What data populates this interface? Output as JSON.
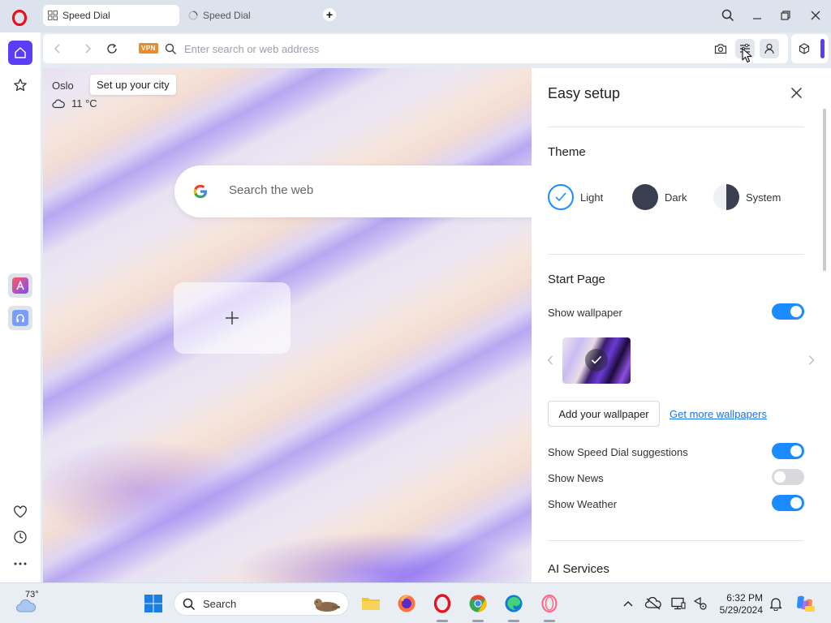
{
  "tabs": [
    {
      "label": "Speed Dial",
      "active": true
    },
    {
      "label": "Speed Dial",
      "active": false
    }
  ],
  "addressbar": {
    "vpn_label": "VPN",
    "placeholder": "Enter search or web address"
  },
  "weather": {
    "city": "Oslo",
    "city_tooltip": "Set up your city",
    "temperature": "11 °C"
  },
  "search": {
    "placeholder": "Search the web"
  },
  "easy_setup": {
    "title": "Easy setup",
    "theme_section": "Theme",
    "themes": [
      {
        "label": "Light",
        "selected": true
      },
      {
        "label": "Dark",
        "selected": false
      },
      {
        "label": "System",
        "selected": false
      }
    ],
    "start_page_section": "Start Page",
    "show_wallpaper": {
      "label": "Show wallpaper",
      "on": true
    },
    "add_wallpaper_button": "Add your wallpaper",
    "more_wallpapers_link": "Get more wallpapers",
    "speed_dial_suggestions": {
      "label": "Show Speed Dial suggestions",
      "on": true
    },
    "show_news": {
      "label": "Show News",
      "on": false
    },
    "show_weather": {
      "label": "Show Weather",
      "on": true
    },
    "ai_section": "AI Services"
  },
  "taskbar": {
    "weather_temp": "73°",
    "search_label": "Search",
    "time": "6:32 PM",
    "date": "5/29/2024"
  },
  "colors": {
    "accent": "#5b3df5",
    "toggle_on": "#1a8cff",
    "link": "#1a73e8",
    "opera_red": "#e6121f"
  }
}
